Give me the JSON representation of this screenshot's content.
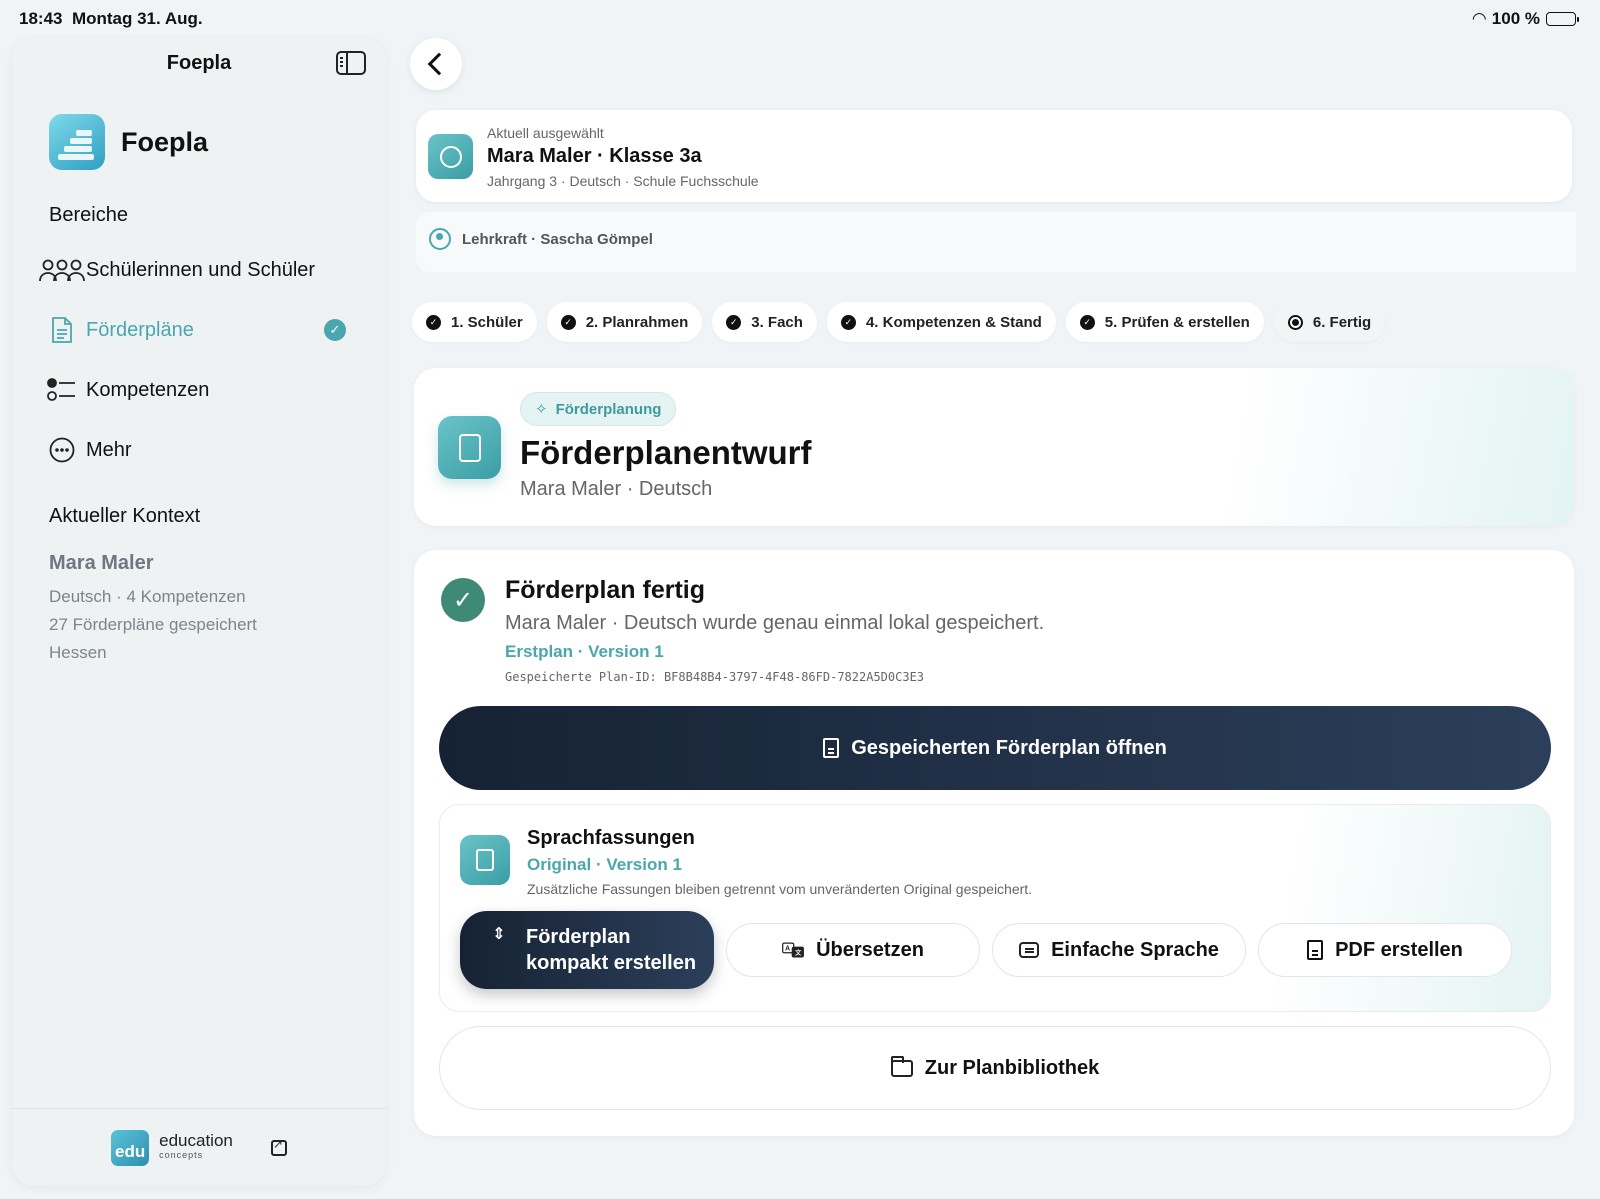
{
  "status": {
    "time": "18:43",
    "date": "Montag 31. Aug.",
    "battery": "100 %"
  },
  "sidebar": {
    "title": "Foepla",
    "brand": "Foepla",
    "section_heading": "Bereiche",
    "items": [
      {
        "label": "Schülerinnen und Schüler",
        "icon": "people-icon"
      },
      {
        "label": "Förderpläne",
        "icon": "document-icon",
        "active": true
      },
      {
        "label": "Kompetenzen",
        "icon": "checklist-icon"
      },
      {
        "label": "Mehr",
        "icon": "more-icon"
      }
    ],
    "context_heading": "Aktueller Kontext",
    "context": {
      "name": "Mara Maler",
      "line1": "Deutsch · 4 Kompetenzen",
      "line2": "27 Förderpläne gespeichert",
      "line3": "Hessen"
    },
    "footer": {
      "logo_text": "edu",
      "brand_line1": "education",
      "brand_line2": "concepts"
    }
  },
  "selection": {
    "label": "Aktuell ausgewählt",
    "title": "Mara Maler · Klasse 3a",
    "subtitle": "Jahrgang 3 · Deutsch · Schule Fuchsschule"
  },
  "teacher": "Lehrkraft · Sascha Gömpel",
  "steps": [
    "1. Schüler",
    "2. Planrahmen",
    "3. Fach",
    "4. Kompetenzen & Stand",
    "5. Prüfen & erstellen",
    "6. Fertig"
  ],
  "hero": {
    "chip": "Förderplanung",
    "title": "Förderplanentwurf",
    "subtitle": "Mara Maler · Deutsch"
  },
  "result": {
    "title": "Förderplan fertig",
    "description": "Mara Maler · Deutsch wurde genau einmal lokal gespeichert.",
    "version": "Erstplan · Version 1",
    "plan_id": "Gespeicherte Plan-ID: BF8B48B4-3797-4F48-86FD-7822A5D0C3E3",
    "open_button": "Gespeicherten Förderplan öffnen"
  },
  "languages": {
    "title": "Sprachfassungen",
    "version": "Original · Version 1",
    "note": "Zusätzliche Fassungen bleiben getrennt vom unveränderten Original gespeichert.",
    "actions": {
      "compact_line1": "Förderplan",
      "compact_line2": "kompakt erstellen",
      "translate": "Übersetzen",
      "simple": "Einfache Sprache",
      "pdf": "PDF erstellen"
    }
  },
  "library_button": "Zur Planbibliothek"
}
